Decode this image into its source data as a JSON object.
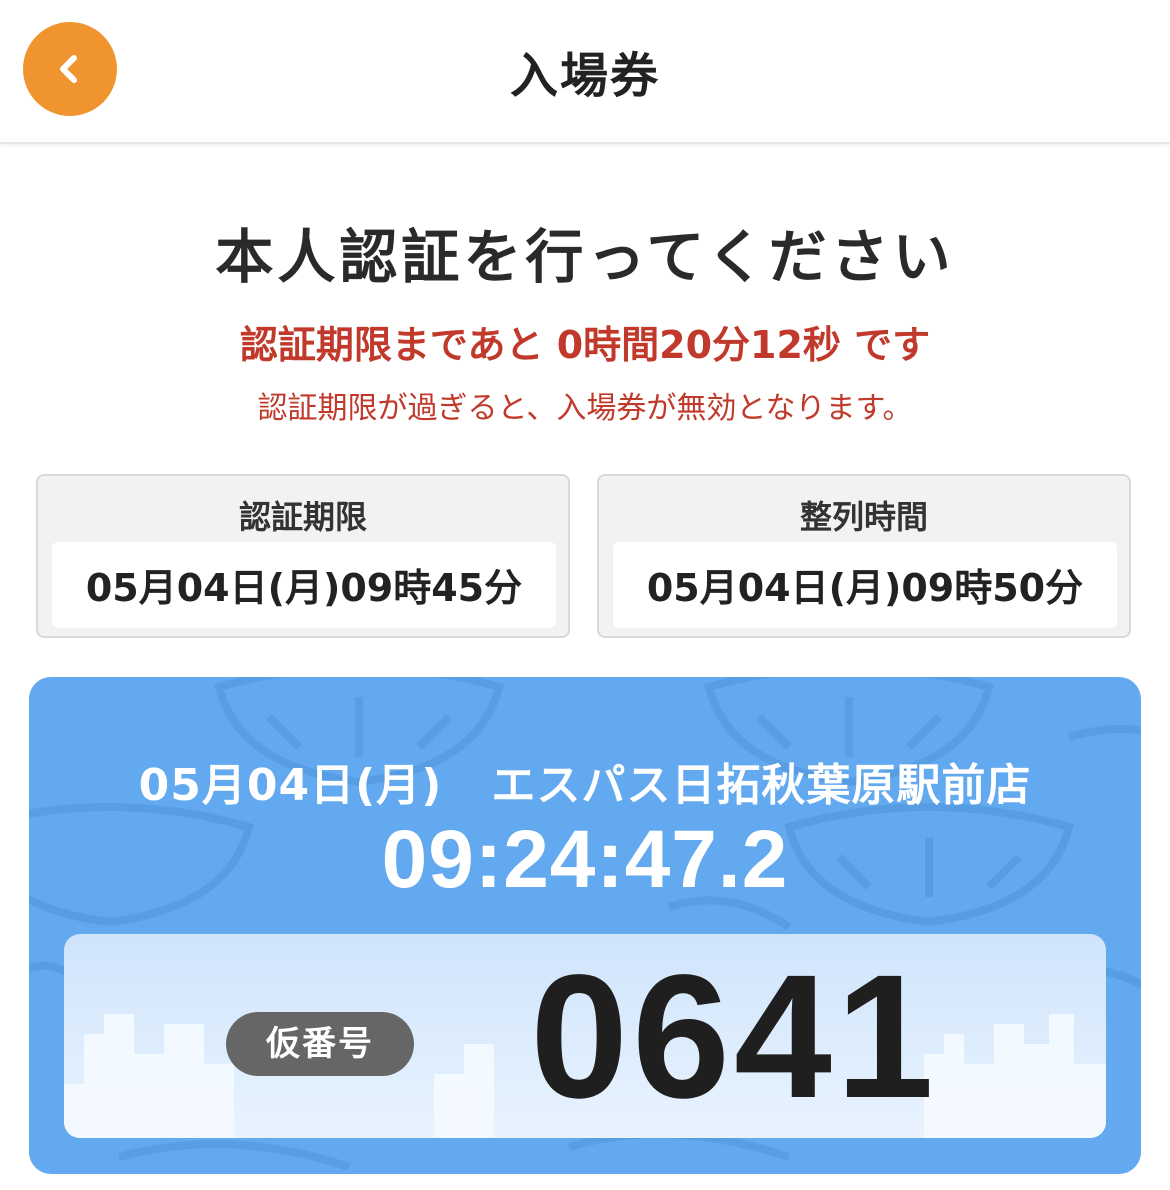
{
  "header": {
    "title": "入場券",
    "back_icon": "chevron-left-icon",
    "accent_color": "#f0942f"
  },
  "auth": {
    "headline": "本人認証を行ってください",
    "deadline_prefix": "認証期限まであと",
    "deadline_remaining": "0時間20分12秒",
    "deadline_suffix": "です",
    "note": "認証期限が過ぎると、入場券が無効となります。",
    "warning_color": "#c0392b"
  },
  "info": {
    "auth_deadline": {
      "label": "認証期限",
      "value": "05月04日(月)09時45分"
    },
    "line_time": {
      "label": "整列時間",
      "value": "05月04日(月)09時50分"
    }
  },
  "ticket": {
    "date": "05月04日(月)",
    "store": "エスパス日拓秋葉原駅前店",
    "clock": "09:24:47.2",
    "temp_label": "仮番号",
    "temp_number": "0641",
    "bg_color": "#62a9ef"
  }
}
